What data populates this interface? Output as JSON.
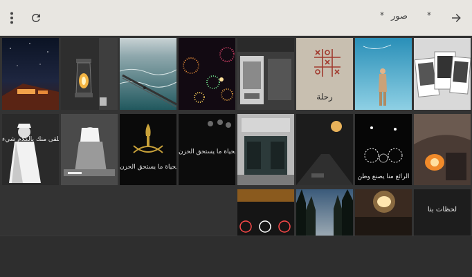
{
  "toolbar": {
    "title": "صور",
    "dot_left": "*",
    "dot_right": "*",
    "menu_icon": "more-vert-icon",
    "refresh_icon": "refresh-icon",
    "back_icon": "arrow-back-icon"
  },
  "photos": [
    {
      "id": "p1",
      "caption": ""
    },
    {
      "id": "p2",
      "caption": ""
    },
    {
      "id": "p3",
      "caption": ""
    },
    {
      "id": "p4",
      "caption": ""
    },
    {
      "id": "p5",
      "caption": ""
    },
    {
      "id": "p6",
      "caption": "رحلة"
    },
    {
      "id": "p7",
      "caption": ""
    },
    {
      "id": "p8",
      "caption": ""
    },
    {
      "id": "p9",
      "caption": "كيف نلقى منك بالكلام شيء"
    },
    {
      "id": "p10",
      "caption": ""
    },
    {
      "id": "p11",
      "caption": "ليس في الحياة ما يستحق الحزن"
    },
    {
      "id": "p12",
      "caption": "في الحياة ما يستحق الحزن"
    },
    {
      "id": "p13",
      "caption": ""
    },
    {
      "id": "p14",
      "caption": ""
    },
    {
      "id": "p15",
      "caption": "الرائع منا يصنع وطن"
    },
    {
      "id": "p16",
      "caption": ""
    },
    {
      "id": "p17",
      "caption": ""
    },
    {
      "id": "p18",
      "caption": ""
    },
    {
      "id": "p19",
      "caption": ""
    },
    {
      "id": "p20",
      "caption": "لحظات بنا"
    }
  ],
  "colors": {
    "appbar": "#e8e6e1",
    "background": "#333333"
  }
}
